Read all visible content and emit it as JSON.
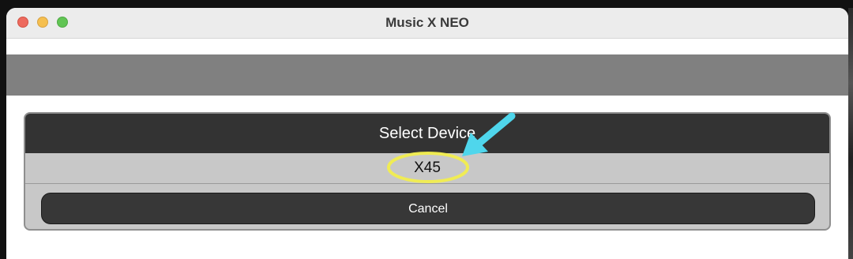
{
  "window": {
    "title": "Music X NEO"
  },
  "dialog": {
    "header": "Select Device",
    "devices": [
      "X45"
    ],
    "cancel_label": "Cancel"
  },
  "colors": {
    "dialog_header": "#333333",
    "dialog_body": "#c8c8c8",
    "toolbar_band": "#808080",
    "annotation_arrow": "#4fd6ec",
    "annotation_circle": "#f2ee4e"
  },
  "icons": {
    "close": "close-icon",
    "minimize": "minimize-icon",
    "maximize": "maximize-icon",
    "annotation": "arrow-icon"
  }
}
